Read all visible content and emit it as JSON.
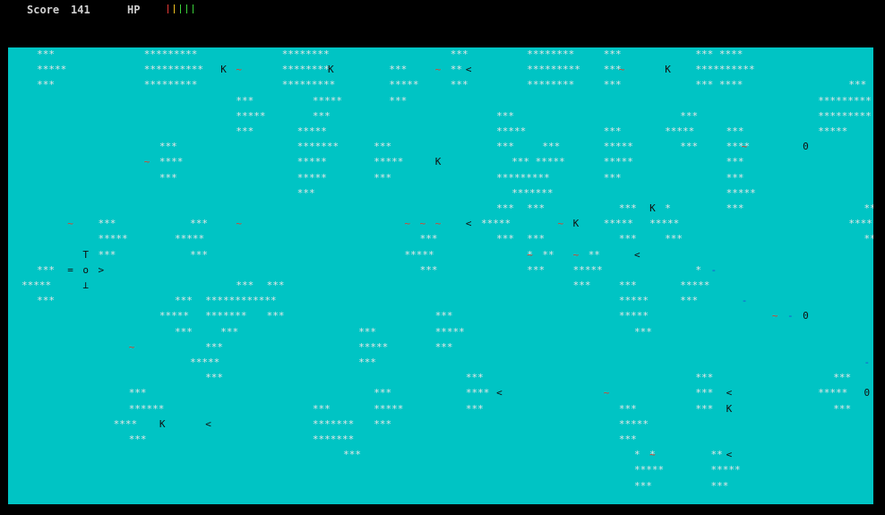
{
  "hud": {
    "score_label": "Score",
    "score_value": "141",
    "hp_label": "HP",
    "hp_bars": [
      "#e53935",
      "#f0c020",
      "#3ad03a",
      "#3ad03a",
      "#3ad03a"
    ]
  },
  "colors": {
    "background": "#000000",
    "playfield": "#00c4c4",
    "cloud": "#e6e6e6",
    "enemy_tilde": "#e0402a",
    "projectile": "#1f4ed0",
    "text": "#111111"
  },
  "cloud_rows": [
    {
      "row": 0,
      "cells": [
        [
          1,
          "***"
        ],
        [
          8,
          "*********"
        ],
        [
          17,
          "********"
        ],
        [
          28,
          "***"
        ],
        [
          33,
          "********"
        ],
        [
          38,
          "***"
        ],
        [
          44,
          "*** ****"
        ]
      ]
    },
    {
      "row": 1,
      "cells": [
        [
          1,
          "*****"
        ],
        [
          8,
          "**********"
        ],
        [
          17,
          "********"
        ],
        [
          24,
          "***"
        ],
        [
          28,
          "**"
        ],
        [
          33,
          "*********"
        ],
        [
          38,
          "***"
        ],
        [
          44,
          "**********"
        ]
      ]
    },
    {
      "row": 2,
      "cells": [
        [
          1,
          "***"
        ],
        [
          8,
          "*********"
        ],
        [
          17,
          "*********"
        ],
        [
          24,
          "*****"
        ],
        [
          28,
          "***"
        ],
        [
          33,
          "********"
        ],
        [
          38,
          "***"
        ],
        [
          44,
          "*** ****"
        ],
        [
          54,
          "***"
        ]
      ]
    },
    {
      "row": 3,
      "cells": [
        [
          14,
          "***"
        ],
        [
          19,
          "*****"
        ],
        [
          24,
          "***"
        ],
        [
          52,
          "*********"
        ]
      ]
    },
    {
      "row": 4,
      "cells": [
        [
          14,
          "*****"
        ],
        [
          19,
          "***"
        ],
        [
          31,
          "***"
        ],
        [
          43,
          "***"
        ],
        [
          52,
          "*********"
        ]
      ]
    },
    {
      "row": 5,
      "cells": [
        [
          14,
          "***"
        ],
        [
          18,
          "*****"
        ],
        [
          31,
          "*****"
        ],
        [
          38,
          "***"
        ],
        [
          42,
          "*****"
        ],
        [
          46,
          "***"
        ],
        [
          52,
          "*****"
        ]
      ]
    },
    {
      "row": 6,
      "cells": [
        [
          9,
          "***"
        ],
        [
          18,
          "*******"
        ],
        [
          23,
          "***"
        ],
        [
          31,
          "***"
        ],
        [
          34,
          "***"
        ],
        [
          38,
          "*****"
        ],
        [
          43,
          "***"
        ],
        [
          46,
          "****"
        ]
      ]
    },
    {
      "row": 7,
      "cells": [
        [
          9,
          "****"
        ],
        [
          18,
          "*****"
        ],
        [
          23,
          "*****"
        ],
        [
          32,
          "*** *****"
        ],
        [
          38,
          "*****"
        ],
        [
          46,
          "***"
        ]
      ]
    },
    {
      "row": 8,
      "cells": [
        [
          9,
          "***"
        ],
        [
          18,
          "*****"
        ],
        [
          23,
          "***"
        ],
        [
          31,
          "*********"
        ],
        [
          38,
          "***"
        ],
        [
          46,
          "***"
        ]
      ]
    },
    {
      "row": 9,
      "cells": [
        [
          18,
          "***"
        ],
        [
          32,
          "*******"
        ],
        [
          46,
          "*****"
        ]
      ]
    },
    {
      "row": 10,
      "cells": [
        [
          31,
          "***"
        ],
        [
          33,
          "***"
        ],
        [
          39,
          "***"
        ],
        [
          42,
          "*"
        ],
        [
          46,
          "***"
        ],
        [
          55,
          "***"
        ]
      ]
    },
    {
      "row": 11,
      "cells": [
        [
          5,
          "***"
        ],
        [
          11,
          "***"
        ],
        [
          30,
          "*****"
        ],
        [
          38,
          "*****"
        ],
        [
          41,
          "*****"
        ],
        [
          54,
          "*****"
        ]
      ]
    },
    {
      "row": 12,
      "cells": [
        [
          5,
          "*****"
        ],
        [
          10,
          "*****"
        ],
        [
          26,
          "***"
        ],
        [
          31,
          "***"
        ],
        [
          33,
          "***"
        ],
        [
          39,
          "***"
        ],
        [
          42,
          "***"
        ],
        [
          55,
          "***"
        ]
      ]
    },
    {
      "row": 13,
      "cells": [
        [
          5,
          "***"
        ],
        [
          11,
          "***"
        ],
        [
          25,
          "*****"
        ],
        [
          33,
          "*"
        ],
        [
          34,
          "**"
        ],
        [
          37,
          "**"
        ]
      ]
    },
    {
      "row": 14,
      "cells": [
        [
          1,
          "***"
        ],
        [
          26,
          "***"
        ],
        [
          33,
          "***"
        ],
        [
          36,
          "*****"
        ],
        [
          44,
          "*"
        ]
      ]
    },
    {
      "row": 15,
      "cells": [
        [
          0,
          "*****"
        ],
        [
          14,
          "***"
        ],
        [
          16,
          "***"
        ],
        [
          36,
          "***"
        ],
        [
          39,
          "***"
        ],
        [
          43,
          "*****"
        ]
      ]
    },
    {
      "row": 16,
      "cells": [
        [
          1,
          "***"
        ],
        [
          10,
          "***"
        ],
        [
          12,
          "************"
        ],
        [
          39,
          "*****"
        ],
        [
          43,
          "***"
        ]
      ]
    },
    {
      "row": 17,
      "cells": [
        [
          9,
          "*****"
        ],
        [
          12,
          "*******"
        ],
        [
          16,
          "***"
        ],
        [
          27,
          "***"
        ],
        [
          39,
          "*****"
        ]
      ]
    },
    {
      "row": 18,
      "cells": [
        [
          10,
          "***"
        ],
        [
          13,
          "***"
        ],
        [
          22,
          "***"
        ],
        [
          27,
          "*****"
        ],
        [
          40,
          "***"
        ]
      ]
    },
    {
      "row": 19,
      "cells": [
        [
          12,
          "***"
        ],
        [
          22,
          "*****"
        ],
        [
          27,
          "***"
        ]
      ]
    },
    {
      "row": 20,
      "cells": [
        [
          11,
          "*****"
        ],
        [
          22,
          "***"
        ]
      ]
    },
    {
      "row": 21,
      "cells": [
        [
          12,
          "***"
        ],
        [
          29,
          "***"
        ],
        [
          44,
          "***"
        ],
        [
          53,
          "***"
        ]
      ]
    },
    {
      "row": 22,
      "cells": [
        [
          7,
          "***"
        ],
        [
          23,
          "***"
        ],
        [
          29,
          "****"
        ],
        [
          44,
          "***"
        ],
        [
          52,
          "*****"
        ]
      ]
    },
    {
      "row": 23,
      "cells": [
        [
          7,
          "******"
        ],
        [
          19,
          "***"
        ],
        [
          23,
          "*****"
        ],
        [
          29,
          "***"
        ],
        [
          39,
          "***"
        ],
        [
          44,
          "***"
        ],
        [
          53,
          "***"
        ]
      ]
    },
    {
      "row": 24,
      "cells": [
        [
          6,
          "****"
        ],
        [
          19,
          "*******"
        ],
        [
          23,
          "***"
        ],
        [
          39,
          "*****"
        ]
      ]
    },
    {
      "row": 25,
      "cells": [
        [
          7,
          "***"
        ],
        [
          19,
          "*******"
        ],
        [
          39,
          "***"
        ]
      ]
    },
    {
      "row": 26,
      "cells": [
        [
          21,
          "***"
        ],
        [
          40,
          "*"
        ],
        [
          41,
          "*"
        ],
        [
          45,
          "**"
        ]
      ]
    },
    {
      "row": 27,
      "cells": [
        [
          40,
          "*****"
        ],
        [
          45,
          "*****"
        ]
      ]
    },
    {
      "row": 28,
      "cells": [
        [
          40,
          "***"
        ],
        [
          45,
          "***"
        ]
      ]
    }
  ],
  "entities": [
    {
      "row": 1,
      "col": 13,
      "glyph": "K",
      "kind": "enemy"
    },
    {
      "row": 1,
      "col": 14,
      "glyph": "~",
      "kind": "tilde"
    },
    {
      "row": 1,
      "col": 20,
      "glyph": "K",
      "kind": "enemy"
    },
    {
      "row": 1,
      "col": 27,
      "glyph": "~",
      "kind": "tilde"
    },
    {
      "row": 1,
      "col": 29,
      "glyph": "<",
      "kind": "shot"
    },
    {
      "row": 1,
      "col": 39,
      "glyph": "~",
      "kind": "tilde"
    },
    {
      "row": 1,
      "col": 42,
      "glyph": "K",
      "kind": "enemy"
    },
    {
      "row": 6,
      "col": 47,
      "glyph": "~",
      "kind": "tilde"
    },
    {
      "row": 6,
      "col": 51,
      "glyph": "0",
      "kind": "mine"
    },
    {
      "row": 7,
      "col": 8,
      "glyph": "~",
      "kind": "tilde"
    },
    {
      "row": 7,
      "col": 27,
      "glyph": "K",
      "kind": "enemy"
    },
    {
      "row": 10,
      "col": 41,
      "glyph": "K",
      "kind": "enemy"
    },
    {
      "row": 11,
      "col": 3,
      "glyph": "~",
      "kind": "tilde"
    },
    {
      "row": 11,
      "col": 14,
      "glyph": "~",
      "kind": "tilde"
    },
    {
      "row": 11,
      "col": 25,
      "glyph": "~",
      "kind": "tilde"
    },
    {
      "row": 11,
      "col": 26,
      "glyph": "~",
      "kind": "tilde"
    },
    {
      "row": 11,
      "col": 27,
      "glyph": "~",
      "kind": "tilde"
    },
    {
      "row": 11,
      "col": 29,
      "glyph": "<",
      "kind": "shot"
    },
    {
      "row": 11,
      "col": 35,
      "glyph": "~",
      "kind": "tilde"
    },
    {
      "row": 11,
      "col": 36,
      "glyph": "K",
      "kind": "enemy"
    },
    {
      "row": 13,
      "col": 33,
      "glyph": "~",
      "kind": "tilde"
    },
    {
      "row": 13,
      "col": 36,
      "glyph": "~",
      "kind": "tilde"
    },
    {
      "row": 13,
      "col": 40,
      "glyph": "<",
      "kind": "shot"
    },
    {
      "row": 14,
      "col": 45,
      "glyph": "-",
      "kind": "bullet"
    },
    {
      "row": 16,
      "col": 47,
      "glyph": "-",
      "kind": "bullet"
    },
    {
      "row": 17,
      "col": 49,
      "glyph": "~",
      "kind": "tilde"
    },
    {
      "row": 17,
      "col": 50,
      "glyph": "-",
      "kind": "bullet"
    },
    {
      "row": 17,
      "col": 51,
      "glyph": "0",
      "kind": "mine"
    },
    {
      "row": 19,
      "col": 7,
      "glyph": "~",
      "kind": "tilde"
    },
    {
      "row": 20,
      "col": 55,
      "glyph": "-",
      "kind": "bullet"
    },
    {
      "row": 22,
      "col": 31,
      "glyph": "<",
      "kind": "shot"
    },
    {
      "row": 22,
      "col": 38,
      "glyph": "~",
      "kind": "tilde"
    },
    {
      "row": 22,
      "col": 46,
      "glyph": "<",
      "kind": "shot"
    },
    {
      "row": 22,
      "col": 55,
      "glyph": "0",
      "kind": "mine"
    },
    {
      "row": 23,
      "col": 46,
      "glyph": "K",
      "kind": "enemy"
    },
    {
      "row": 24,
      "col": 9,
      "glyph": "K",
      "kind": "enemy"
    },
    {
      "row": 24,
      "col": 12,
      "glyph": "<",
      "kind": "shot"
    },
    {
      "row": 26,
      "col": 41,
      "glyph": "~",
      "kind": "tilde"
    },
    {
      "row": 26,
      "col": 46,
      "glyph": "<",
      "kind": "shot"
    }
  ],
  "player": [
    {
      "row": 13,
      "col": 4,
      "glyph": "T"
    },
    {
      "row": 14,
      "col": 3,
      "glyph": "="
    },
    {
      "row": 14,
      "col": 4,
      "glyph": "o"
    },
    {
      "row": 14,
      "col": 5,
      "glyph": ">"
    },
    {
      "row": 15,
      "col": 4,
      "glyph": "⊥"
    }
  ]
}
